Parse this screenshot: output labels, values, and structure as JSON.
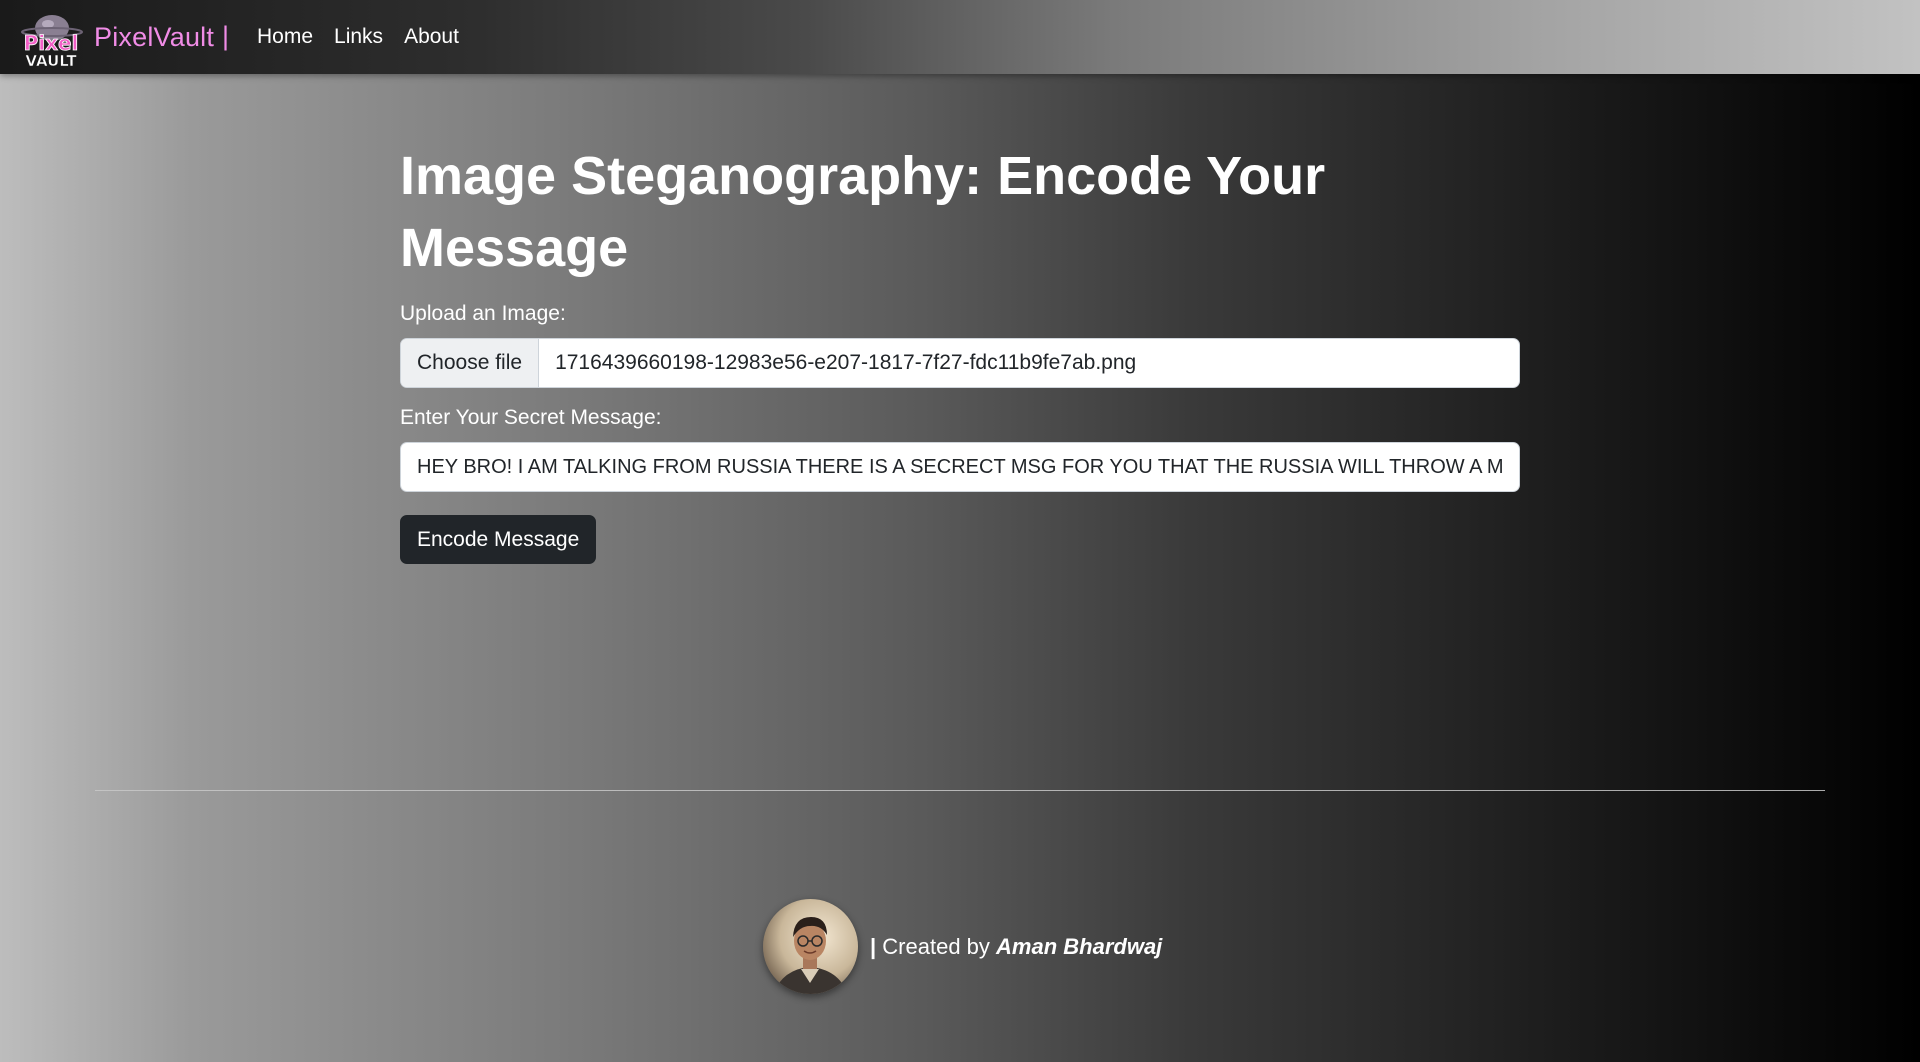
{
  "navbar": {
    "logo_text": "Pixel VAULT",
    "brand": "PixelVault",
    "separator": "|",
    "links": [
      {
        "label": "Home"
      },
      {
        "label": "Links"
      },
      {
        "label": "About"
      }
    ]
  },
  "main": {
    "title": "Image Steganography: Encode Your Message",
    "upload_label": "Upload an Image:",
    "choose_file_button": "Choose file",
    "file_name": "1716439660198-12983e56-e207-1817-7f27-fdc11b9fe7ab.png",
    "message_label": "Enter Your Secret Message:",
    "message_value": "HEY BRO! I AM TALKING FROM RUSSIA THERE IS A SECRECT MSG FOR YOU THAT THE RUSSIA WILL THROW A MISSILE",
    "encode_button": "Encode Message"
  },
  "footer": {
    "bar": "|",
    "created_by": "Created by",
    "author": "Aman Bhardwaj"
  },
  "colors": {
    "brand_pink": "#f08ce6",
    "button_dark": "#212529"
  }
}
